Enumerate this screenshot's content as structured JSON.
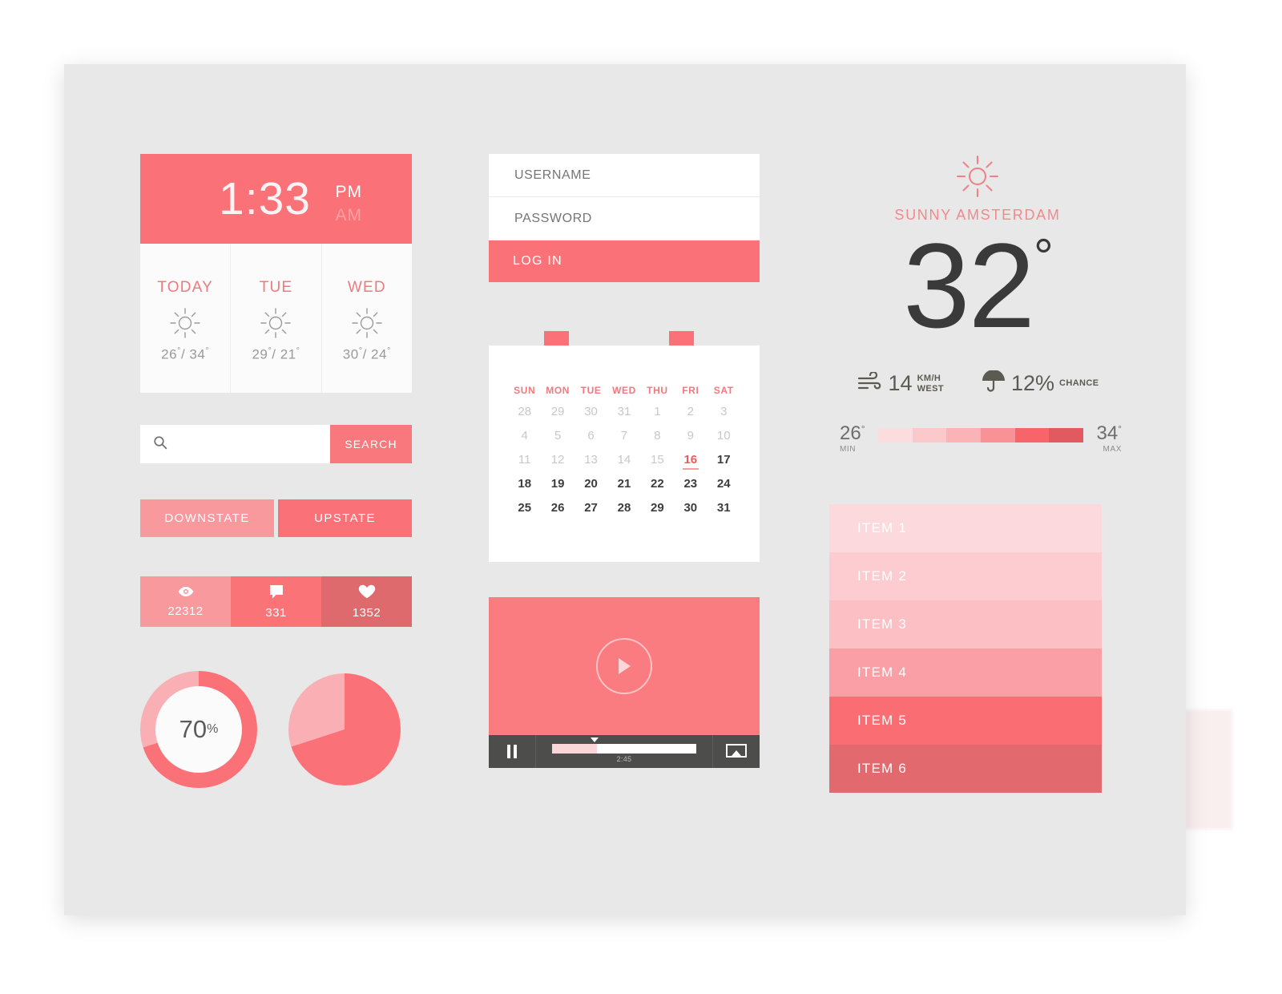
{
  "palette": {
    "background": "#E8E8E8",
    "accent": "#FA7277",
    "accent_light": "#F8999E",
    "accent_dark": "#DF6A6E",
    "text_dark": "#3A3A3A",
    "text_muted": "#9A9A9A"
  },
  "clock": {
    "time": "1:33",
    "meridiem_active": "PM",
    "meridiem_inactive": "AM"
  },
  "forecast": [
    {
      "day": "TODAY",
      "icon": "sun-icon",
      "temp_low": "26",
      "temp_high": "34"
    },
    {
      "day": "TUE",
      "icon": "sun-icon",
      "temp_low": "29",
      "temp_high": "21"
    },
    {
      "day": "WED",
      "icon": "sun-icon",
      "temp_low": "30",
      "temp_high": "24"
    }
  ],
  "search": {
    "icon": "search-icon",
    "placeholder": "",
    "value": "",
    "button_label": "SEARCH"
  },
  "state_buttons": {
    "down_label": "DOWNSTATE",
    "up_label": "UPSTATE"
  },
  "stats": [
    {
      "icon": "eye-icon",
      "value": "22312"
    },
    {
      "icon": "comment-icon",
      "value": "331"
    },
    {
      "icon": "heart-icon",
      "value": "1352"
    }
  ],
  "progress_circles": {
    "donut_percent": "70",
    "donut_suffix": "%",
    "donut_value": 70,
    "pie_value": 70
  },
  "login": {
    "username_placeholder": "USERNAME",
    "username_value": "",
    "password_placeholder": "PASSWORD",
    "password_value": "",
    "submit_label": "LOG IN"
  },
  "calendar": {
    "weekdays": [
      "SUN",
      "MON",
      "TUE",
      "WED",
      "THU",
      "FRI",
      "SAT"
    ],
    "weeks": [
      [
        {
          "d": "28",
          "s": "muted"
        },
        {
          "d": "29",
          "s": "muted"
        },
        {
          "d": "30",
          "s": "muted"
        },
        {
          "d": "31",
          "s": "muted"
        },
        {
          "d": "1",
          "s": "muted"
        },
        {
          "d": "2",
          "s": "muted"
        },
        {
          "d": "3",
          "s": "muted"
        }
      ],
      [
        {
          "d": "4",
          "s": "muted"
        },
        {
          "d": "5",
          "s": "muted"
        },
        {
          "d": "6",
          "s": "muted"
        },
        {
          "d": "7",
          "s": "muted"
        },
        {
          "d": "8",
          "s": "muted"
        },
        {
          "d": "9",
          "s": "muted"
        },
        {
          "d": "10",
          "s": "muted"
        }
      ],
      [
        {
          "d": "11",
          "s": "muted"
        },
        {
          "d": "12",
          "s": "muted"
        },
        {
          "d": "13",
          "s": "muted"
        },
        {
          "d": "14",
          "s": "muted"
        },
        {
          "d": "15",
          "s": "muted"
        },
        {
          "d": "16",
          "s": "today"
        },
        {
          "d": "17",
          "s": "normal"
        }
      ],
      [
        {
          "d": "18",
          "s": "normal"
        },
        {
          "d": "19",
          "s": "normal"
        },
        {
          "d": "20",
          "s": "normal"
        },
        {
          "d": "21",
          "s": "normal"
        },
        {
          "d": "22",
          "s": "normal"
        },
        {
          "d": "23",
          "s": "normal"
        },
        {
          "d": "24",
          "s": "normal"
        }
      ],
      [
        {
          "d": "25",
          "s": "normal"
        },
        {
          "d": "26",
          "s": "normal"
        },
        {
          "d": "27",
          "s": "normal"
        },
        {
          "d": "28",
          "s": "normal"
        },
        {
          "d": "29",
          "s": "normal"
        },
        {
          "d": "30",
          "s": "normal"
        },
        {
          "d": "31",
          "s": "normal"
        }
      ]
    ]
  },
  "video": {
    "play_icon": "play-icon",
    "pause_icon": "pause-icon",
    "airplay_icon": "airplay-icon",
    "time": "2:45",
    "progress_percent": 30
  },
  "weather": {
    "condition_icon": "sun-icon",
    "caption": "SUNNY AMSTERDAM",
    "temperature": "32",
    "degree": "°",
    "wind": {
      "icon": "wind-icon",
      "value": "14",
      "unit_line1": "KM/H",
      "unit_line2": "WEST"
    },
    "rain": {
      "icon": "umbrella-icon",
      "value": "12%",
      "unit_line1": "CHANCE",
      "unit_line2": ""
    },
    "range": {
      "min_value": "26",
      "min_label": "MIN",
      "max_value": "34",
      "max_label": "MAX",
      "gradient": [
        "#FCDCDE",
        "#FBC9CC",
        "#FAB4B7",
        "#F99296",
        "#F7656B",
        "#E15A60"
      ]
    }
  },
  "items": [
    {
      "label": "ITEM 1",
      "color": "#FBD9DC"
    },
    {
      "label": "ITEM 2",
      "color": "#FCCCD0"
    },
    {
      "label": "ITEM 3",
      "color": "#FBBFC4"
    },
    {
      "label": "ITEM 4",
      "color": "#FA9FA5"
    },
    {
      "label": "ITEM 5",
      "color": "#FA6E73"
    },
    {
      "label": "ITEM 6",
      "color": "#E2696E"
    }
  ]
}
